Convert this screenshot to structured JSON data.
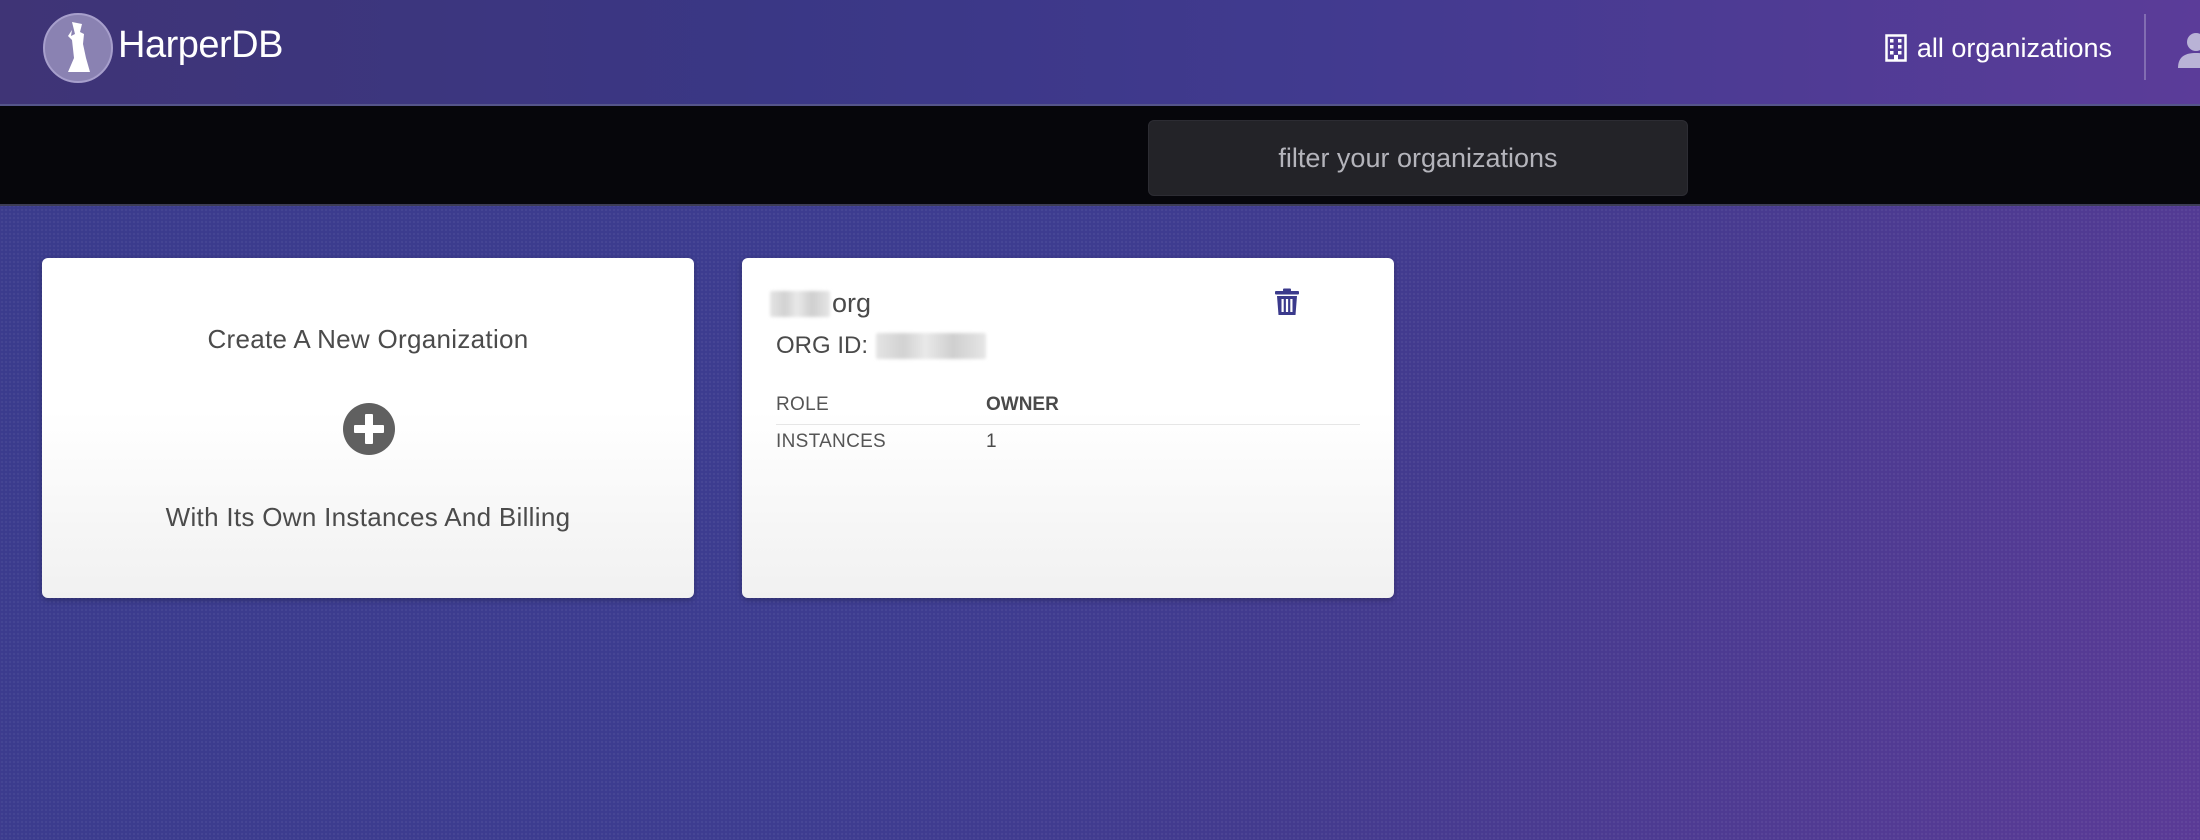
{
  "header": {
    "brand": "HarperDB",
    "org_link_label": "all organizations",
    "icons": {
      "logo": "harperdb-dog-logo",
      "org": "building-icon",
      "user": "user-icon"
    }
  },
  "filter": {
    "placeholder": "filter your organizations",
    "value": ""
  },
  "create_card": {
    "title": "Create A New Organization",
    "subtitle": "With Its Own Instances And Billing",
    "icon": "plus-circle-icon"
  },
  "org_card": {
    "name_suffix": "org",
    "org_id_label": "ORG ID:",
    "rows": [
      {
        "key": "ROLE",
        "value": "OWNER"
      },
      {
        "key": "INSTANCES",
        "value": "1"
      }
    ],
    "icon": "trash-icon"
  },
  "colors": {
    "accent": "#3a3785",
    "icon_dark": "#606060",
    "trash": "#3b3a8c",
    "filter_bg": "#232328",
    "bar_bg": "#06060b"
  }
}
